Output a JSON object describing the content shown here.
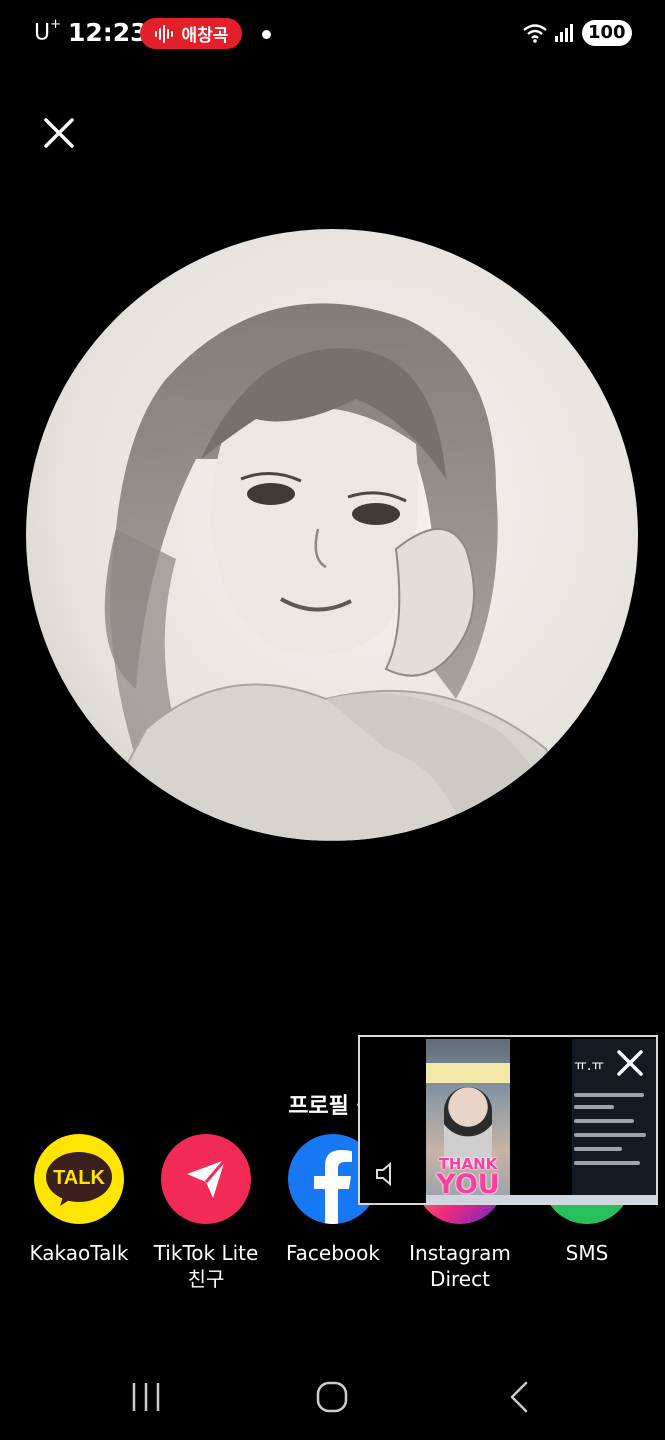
{
  "status_bar": {
    "carrier": "U",
    "carrier_sup": "+",
    "time": "12:23",
    "pill_label": "애창곡",
    "battery": "100",
    "pill_color": "#e3202a"
  },
  "profile": {
    "close_icon": "close-icon",
    "photo": "pencil-sketch-portrait"
  },
  "share": {
    "title": "프로필 공",
    "apps": [
      {
        "label": "KakaoTalk",
        "icon": "kakaotalk-icon",
        "color": "#ffe600",
        "badge": "TALK"
      },
      {
        "label": "TikTok Lite",
        "label2": "친구",
        "icon": "tiktok-lite-icon",
        "color": "#f12b55"
      },
      {
        "label": "Facebook",
        "icon": "facebook-icon",
        "color": "#1877f2",
        "glyph": "f"
      },
      {
        "label": "Instagram",
        "label2": "Direct",
        "icon": "instagram-icon",
        "color": "#fa7e1e"
      },
      {
        "label": "SMS",
        "icon": "sms-icon",
        "color": "#2bbf5b"
      }
    ]
  },
  "pip": {
    "thanks_line1": "THANK",
    "thanks_line2": "YOU",
    "chat_head": "ㅠ.ㅠ"
  },
  "nav": {
    "recents": "recents-icon",
    "home": "home-icon",
    "back": "back-icon"
  }
}
